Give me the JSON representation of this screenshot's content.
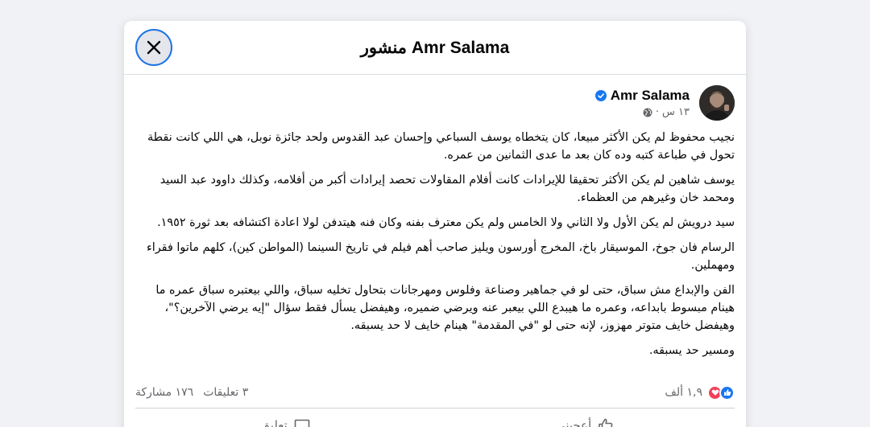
{
  "modal": {
    "title": "منشور Amr Salama",
    "close_icon": "close-icon"
  },
  "post": {
    "author": "Amr Salama",
    "verified_icon": "verified-badge-icon",
    "time": "١٣ س",
    "separator": "·",
    "audience_icon": "globe-icon",
    "paragraphs": [
      "نجيب محفوظ لم يكن الأكثر مبيعا، كان يتخطاه يوسف السباعي وإحسان عبد القدوس ولحد جائزة نوبل، هي اللي كانت نقطة تحول في طباعة كتبه وده كان بعد ما عدى الثمانين من عمره.",
      "يوسف شاهين لم يكن الأكثر تحقيقا للإيرادات كانت أفلام المقاولات تحصد إيرادات أكبر من أفلامه، وكذلك داوود عبد السيد ومحمد خان وغيرهم من العظماء.",
      "سيد درويش لم يكن الأول ولا الثاني ولا الخامس ولم يكن معترف بفنه وكان فنه هيتدفن لولا اعادة اكتشافه بعد ثورة ١٩٥٢.",
      "الرسام فان جوخ، الموسيقار باخ، المخرج أورسون ويليز صاحب أهم فيلم في تاريخ السينما (المواطن كين)، كلهم ماتوا فقراء ومهملين.",
      "الفن والإبداع مش سباق، حتى لو في جماهير وصناعة وفلوس ومهرجانات بتحاول تخليه سباق، واللي بيعتبره سباق عمره ما هينام مبسوط بابداعه، وعمره ما هيبدع اللي بيعبر عنه ويرضي ضميره، وهيفضل يسأل فقط سؤال \"إيه يرضي الآخرين؟\"، وهيفضل خايف متوتر مهزوز، لإنه حتى لو \"في المقدمة\" هينام خايف لا حد يسبقه.",
      "ومسير حد يسبقه."
    ]
  },
  "stats": {
    "reactions_count": "١,٩ ألف",
    "comments": "٣ تعليقات",
    "shares": "١٧٦ مشاركة",
    "reaction_icons": [
      "like-icon",
      "love-icon"
    ]
  },
  "actions": {
    "like_label": "أعجبني",
    "comment_label": "تعليق"
  },
  "colors": {
    "accent": "#1877f2",
    "love": "#f33e58",
    "secondary_text": "#65676b",
    "background": "#f0f2f5"
  }
}
